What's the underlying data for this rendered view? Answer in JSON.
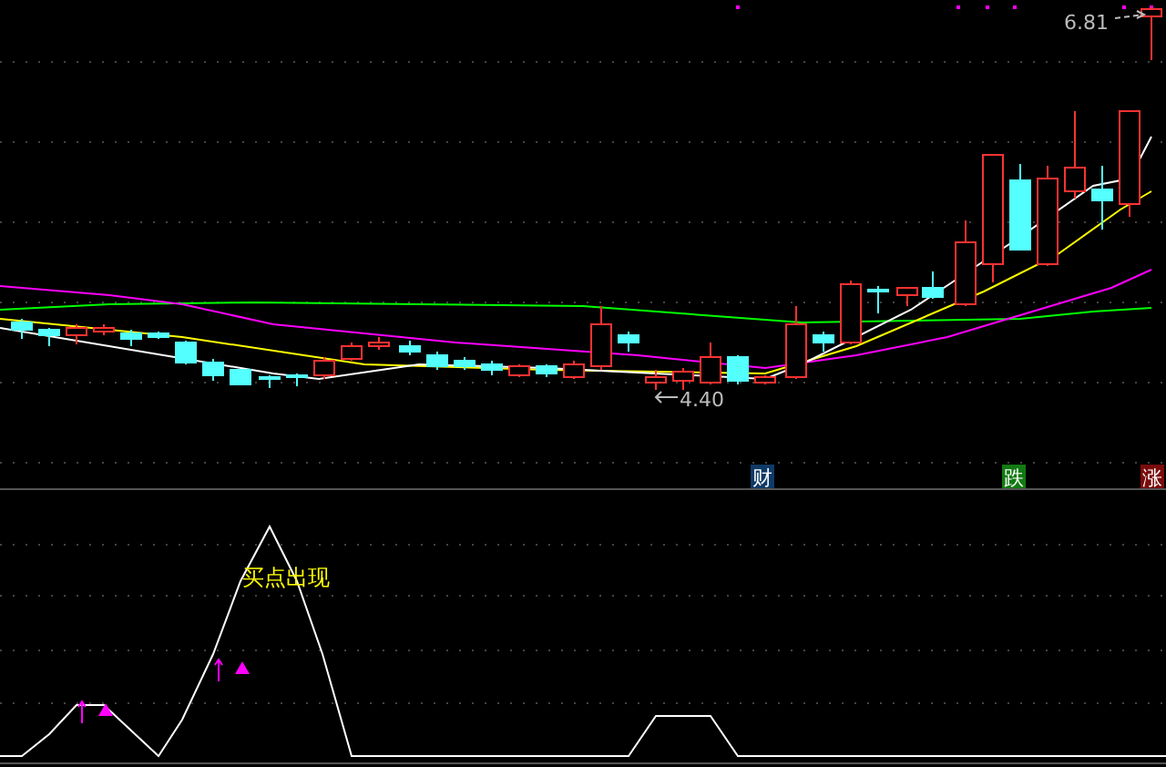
{
  "price_chart": {
    "high_label": "6.81",
    "low_label": "4.40",
    "event_tags": [
      {
        "label": "财",
        "color": "#0f3a66"
      },
      {
        "label": "跌",
        "color": "#127a12"
      },
      {
        "label": "涨",
        "color": "#7a0c0c"
      }
    ]
  },
  "indicator": {
    "signal_text": "买点出现"
  }
}
